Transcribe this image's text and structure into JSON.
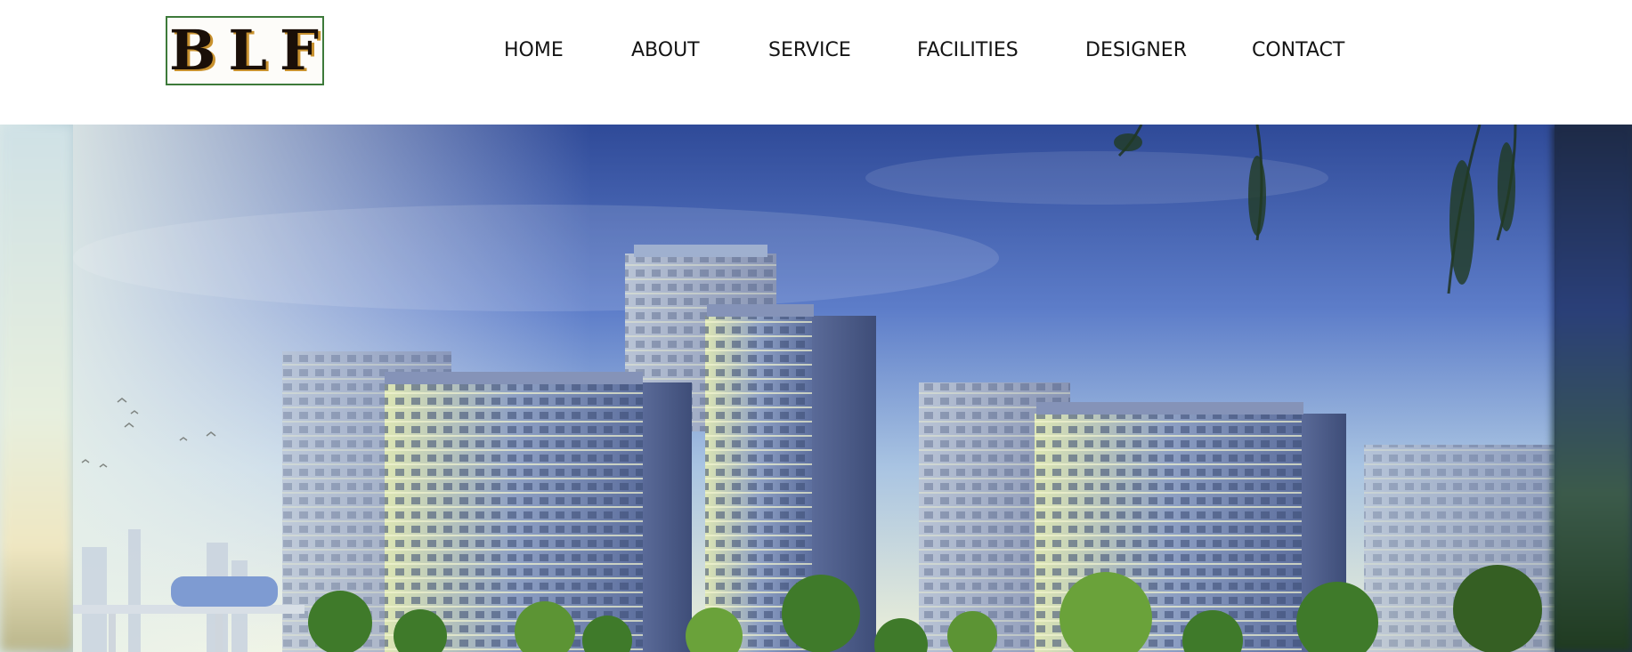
{
  "brand": {
    "logo_text": "BLF"
  },
  "nav": {
    "items": [
      {
        "label": "HOME"
      },
      {
        "label": "ABOUT"
      },
      {
        "label": "SERVICE"
      },
      {
        "label": "FACILITIES"
      },
      {
        "label": "DESIGNER"
      },
      {
        "label": "CONTACT"
      }
    ]
  },
  "hero": {
    "image": "city-apartment-towers-image",
    "colors": {
      "sky_top": "#2c4a9a",
      "sky_bottom": "#e9f1e9",
      "tower": "#6f84b8",
      "tower_light": "#dfe8b0",
      "tree": "#3f7a2a"
    }
  }
}
